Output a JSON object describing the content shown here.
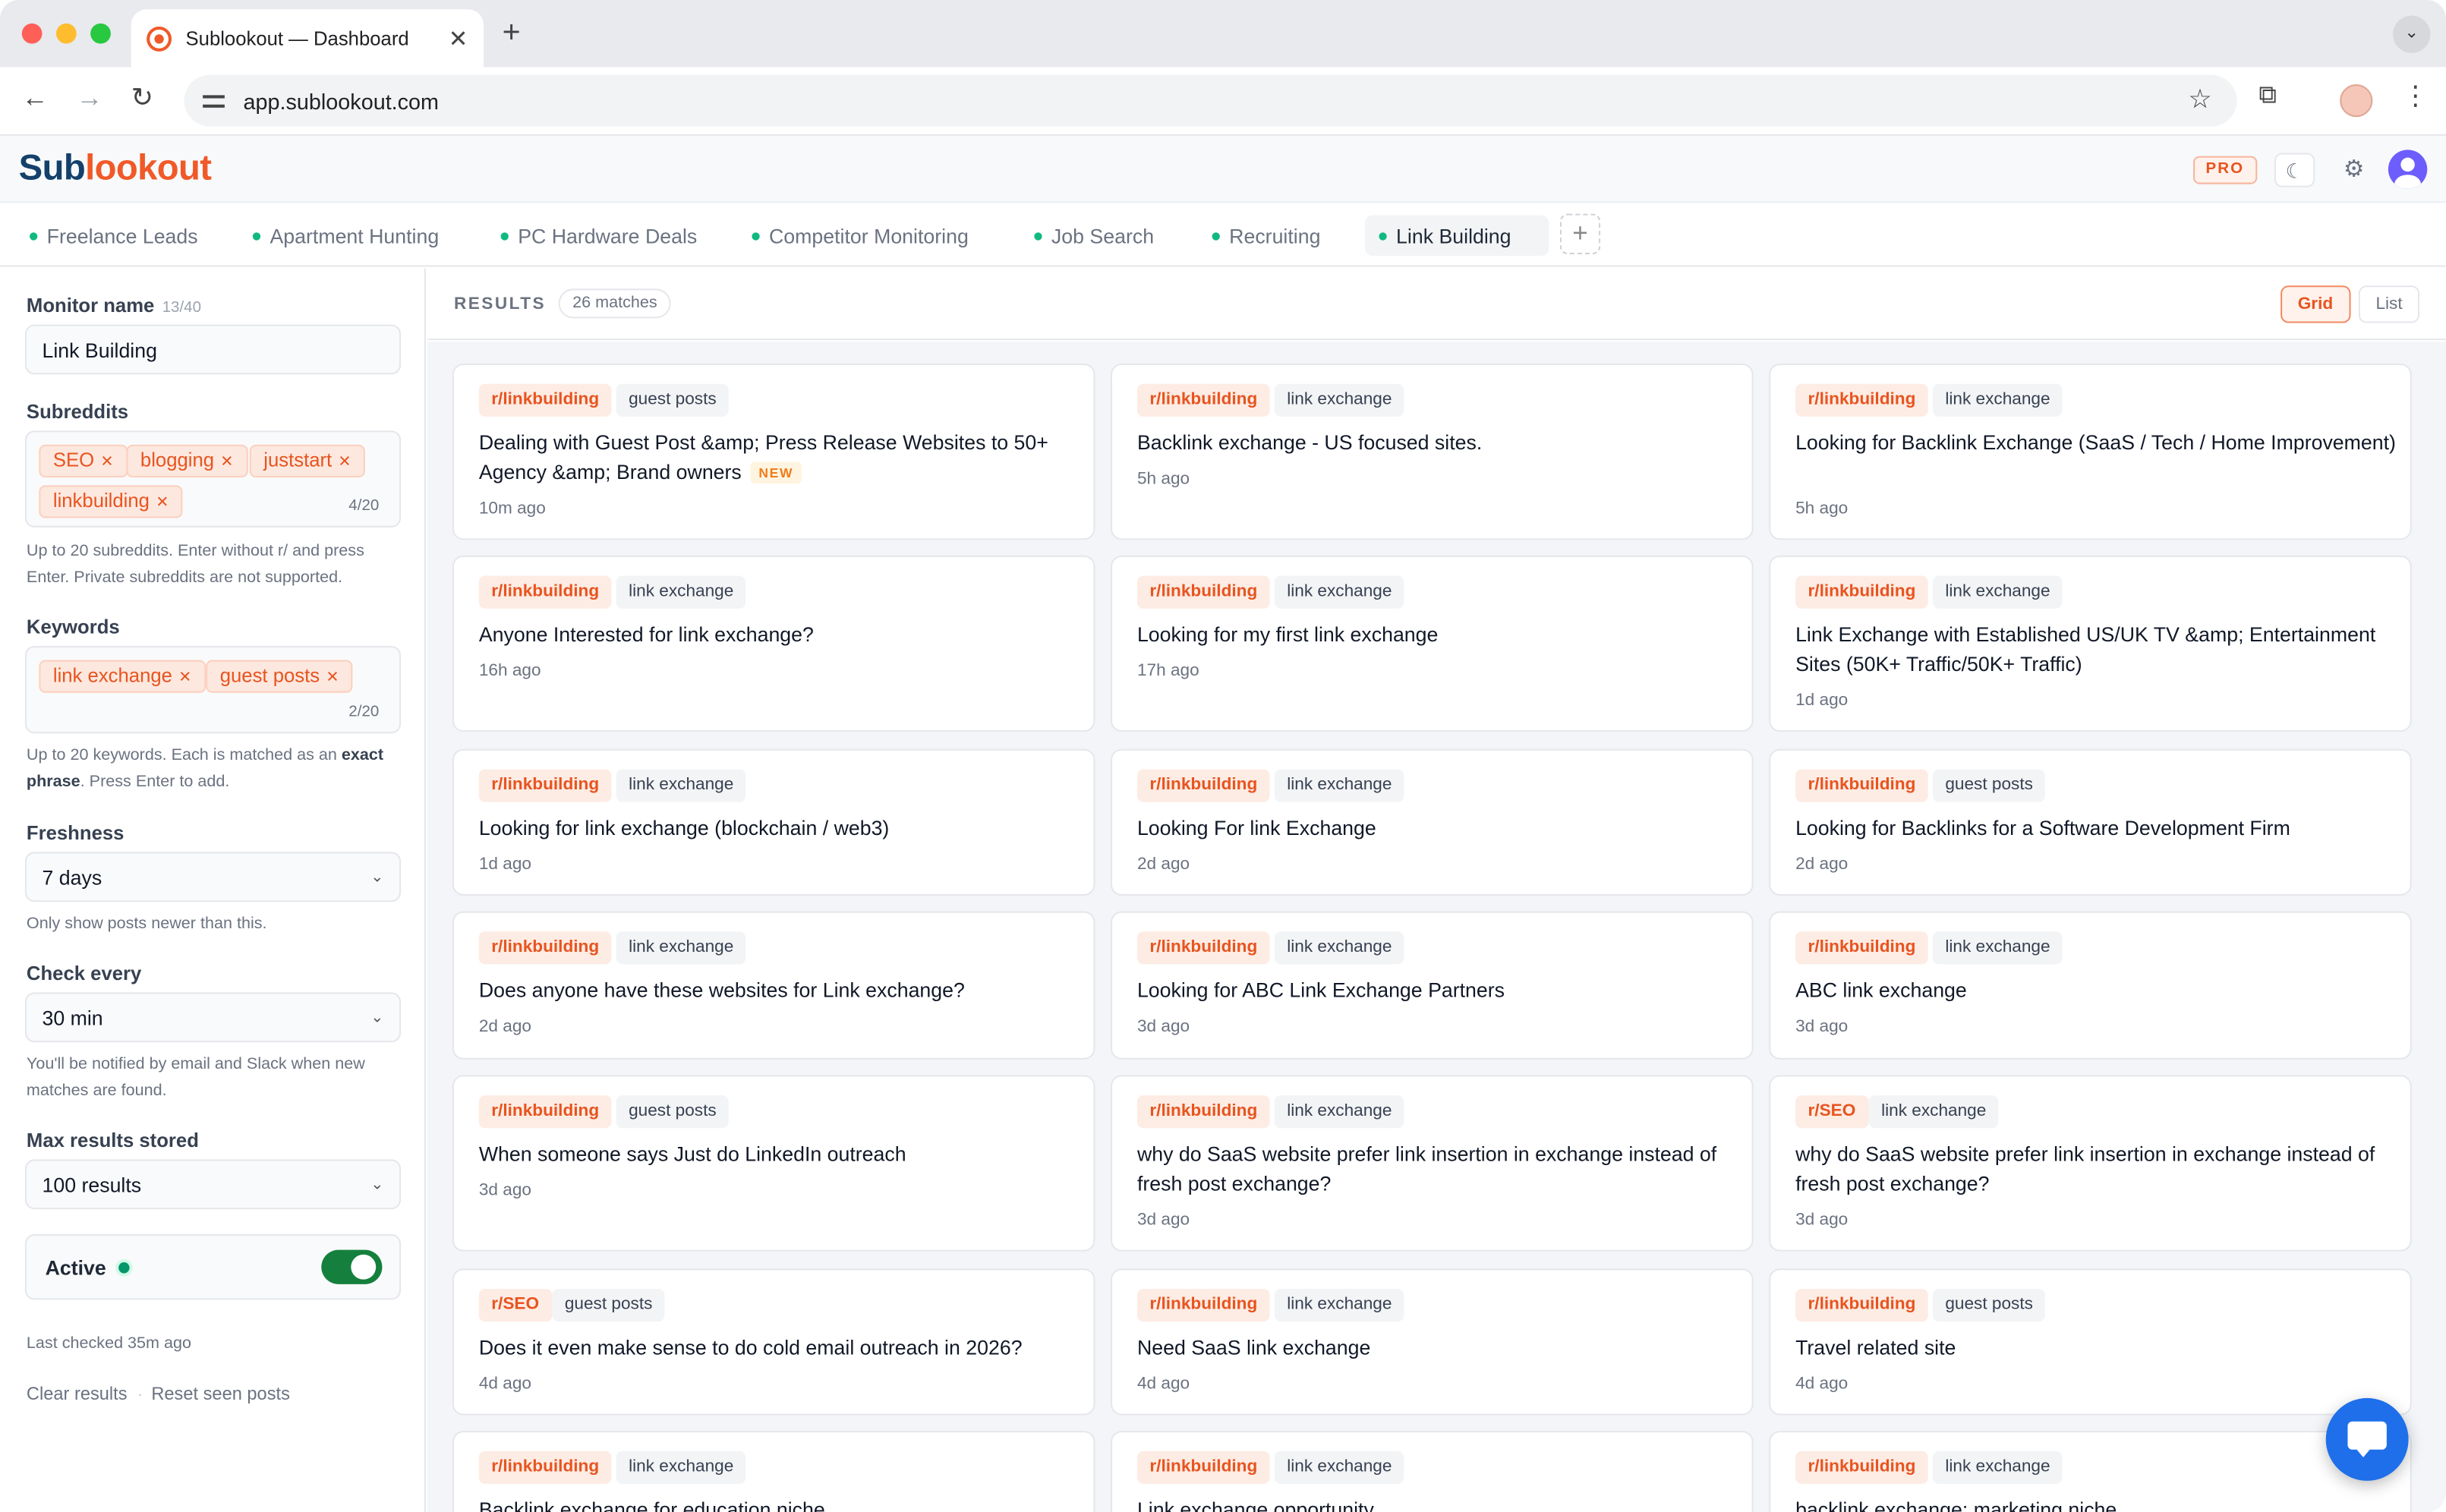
{
  "browser": {
    "tab_title": "Sublookout — Dashboard",
    "tab_close": "✕",
    "new_tab": "+",
    "url": "app.sublookout.com",
    "back": "←",
    "forward": "→",
    "reload": "↻",
    "star": "☆",
    "extensions": "⧉",
    "menu": "⋮",
    "tab_menu": "⌄"
  },
  "app": {
    "logo_part1": "Sub",
    "logo_part2": "lookout",
    "plan_badge": "PRO",
    "theme_icon": "☾",
    "settings_icon": "⚙",
    "brand_color": "#f05a28",
    "logo_color": "#14406b"
  },
  "monitor_tabs": [
    {
      "label": "Freelance Leads"
    },
    {
      "label": "Apartment Hunting"
    },
    {
      "label": "PC Hardware Deals"
    },
    {
      "label": "Competitor Monitoring"
    },
    {
      "label": "Job Search"
    },
    {
      "label": "Recruiting"
    },
    {
      "label": "Link Building"
    }
  ],
  "add_tab": "+",
  "sidebar": {
    "monitor_name_label": "Monitor name",
    "monitor_name_count": "13/40",
    "monitor_name_value": "Link Building",
    "subreddits_label": "Subreddits",
    "subreddits": [
      "SEO",
      "blogging",
      "juststart",
      "linkbuilding"
    ],
    "subreddits_count": "4/20",
    "subreddits_help": "Up to 20 subreddits. Enter without r/ and press Enter. Private subreddits are not supported.",
    "keywords_label": "Keywords",
    "keywords": [
      "link exchange",
      "guest posts"
    ],
    "keywords_count": "2/20",
    "keywords_help_1": "Up to 20 keywords. Each is matched as an",
    "keywords_help_bold": "exact phrase",
    "keywords_help_2": ". Press Enter to add.",
    "freshness_label": "Freshness",
    "freshness_value": "7 days",
    "freshness_help": "Only show posts newer than this.",
    "check_label": "Check every",
    "check_value": "30 min",
    "check_help": "You'll be notified by email and Slack when new matches are found.",
    "max_label": "Max results stored",
    "max_value": "100 results",
    "active_label": "Active",
    "active": true,
    "last_checked": "Last checked 35m ago",
    "clear_results": "Clear results",
    "separator": "·",
    "reset_seen": "Reset seen posts",
    "remove_glyph": "✕",
    "chevron_glyph": "⌄"
  },
  "results": {
    "title": "RESULTS",
    "matches": "26 matches",
    "view_grid": "Grid",
    "view_list": "List",
    "new_badge": "NEW",
    "cards": [
      {
        "sub": "r/linkbuilding",
        "kw": "guest posts",
        "title": "Dealing with Guest Post &amp; Press Release Websites to 50+ Agency &amp; Brand owners",
        "time": "10m ago",
        "is_new": true
      },
      {
        "sub": "r/linkbuilding",
        "kw": "link exchange",
        "title": "Backlink exchange - US focused sites.",
        "time": "5h ago"
      },
      {
        "sub": "r/linkbuilding",
        "kw": "link exchange",
        "title": "Looking for Backlink Exchange (SaaS / Tech / Home Improvement)",
        "time": "5h ago"
      },
      {
        "sub": "r/linkbuilding",
        "kw": "link exchange",
        "title": "Anyone Interested for link exchange?",
        "time": "16h ago"
      },
      {
        "sub": "r/linkbuilding",
        "kw": "link exchange",
        "title": "Looking for my first link exchange",
        "time": "17h ago"
      },
      {
        "sub": "r/linkbuilding",
        "kw": "link exchange",
        "title": "Link Exchange with Established US/UK TV &amp; Entertainment Sites (50K+ Traffic/50K+ Traffic)",
        "time": "1d ago"
      },
      {
        "sub": "r/linkbuilding",
        "kw": "link exchange",
        "title": "Looking for link exchange (blockchain / web3)",
        "time": "1d ago"
      },
      {
        "sub": "r/linkbuilding",
        "kw": "link exchange",
        "title": "Looking For link Exchange",
        "time": "2d ago"
      },
      {
        "sub": "r/linkbuilding",
        "kw": "guest posts",
        "title": "Looking for Backlinks for a Software Development Firm",
        "time": "2d ago"
      },
      {
        "sub": "r/linkbuilding",
        "kw": "link exchange",
        "title": "Does anyone have these websites for Link exchange?",
        "time": "2d ago"
      },
      {
        "sub": "r/linkbuilding",
        "kw": "link exchange",
        "title": "Looking for ABC Link Exchange Partners",
        "time": "3d ago"
      },
      {
        "sub": "r/linkbuilding",
        "kw": "link exchange",
        "title": "ABC link exchange",
        "time": "3d ago"
      },
      {
        "sub": "r/linkbuilding",
        "kw": "guest posts",
        "title": "When someone says Just do LinkedIn outreach",
        "time": "3d ago"
      },
      {
        "sub": "r/linkbuilding",
        "kw": "link exchange",
        "title": "why do SaaS website prefer link insertion in exchange instead of fresh post exchange?",
        "time": "3d ago"
      },
      {
        "sub": "r/SEO",
        "kw": "link exchange",
        "title": "why do SaaS website prefer link insertion in exchange instead of fresh post exchange?",
        "time": "3d ago"
      },
      {
        "sub": "r/SEO",
        "kw": "guest posts",
        "title": "Does it even make sense to do cold email outreach in 2026?",
        "time": "4d ago"
      },
      {
        "sub": "r/linkbuilding",
        "kw": "link exchange",
        "title": "Need SaaS link exchange",
        "time": "4d ago"
      },
      {
        "sub": "r/linkbuilding",
        "kw": "guest posts",
        "title": "Travel related site",
        "time": "4d ago"
      },
      {
        "sub": "r/linkbuilding",
        "kw": "link exchange",
        "title": "Backlink exchange for education niche",
        "time": ""
      },
      {
        "sub": "r/linkbuilding",
        "kw": "link exchange",
        "title": "Link exchange opportunity",
        "time": ""
      },
      {
        "sub": "r/linkbuilding",
        "kw": "link exchange",
        "title": "backlink exchange: marketing niche",
        "time": ""
      }
    ]
  }
}
